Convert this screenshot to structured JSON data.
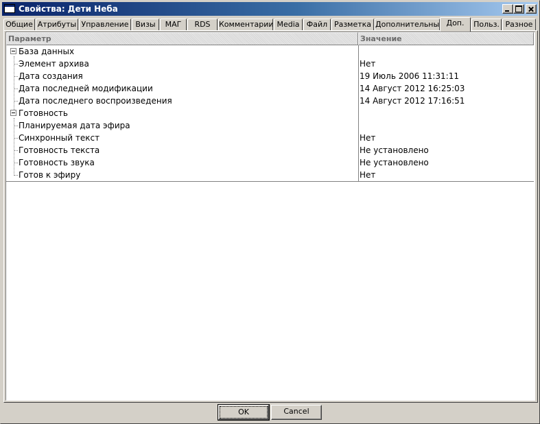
{
  "window": {
    "title": "Свойства: Дети Неба"
  },
  "tabs": [
    {
      "label": "Общие"
    },
    {
      "label": "Атрибуты"
    },
    {
      "label": "Управление"
    },
    {
      "label": "Визы"
    },
    {
      "label": "МАГ"
    },
    {
      "label": "RDS"
    },
    {
      "label": "Комментарии"
    },
    {
      "label": "Media"
    },
    {
      "label": "Файл"
    },
    {
      "label": "Разметка"
    },
    {
      "label": "Дополнительные"
    },
    {
      "label": "Доп.",
      "active": true
    },
    {
      "label": "Польз."
    },
    {
      "label": "Разное"
    }
  ],
  "grid": {
    "columns": {
      "param": "Параметр",
      "value": "Значение"
    },
    "groups": [
      {
        "label": "База данных",
        "rows": [
          {
            "param": "Элемент архива",
            "value": "Нет"
          },
          {
            "param": "Дата создания",
            "value": "19 Июль 2006  11:31:11"
          },
          {
            "param": "Дата последней модификации",
            "value": "14 Август 2012  16:25:03"
          },
          {
            "param": "Дата последнего воспроизведения",
            "value": "14 Август 2012  17:16:51"
          }
        ]
      },
      {
        "label": "Готовность",
        "rows": [
          {
            "param": "Планируемая дата эфира",
            "value": ""
          },
          {
            "param": "Синхронный текст",
            "value": "Нет"
          },
          {
            "param": "Готовность текста",
            "value": "Не установлено"
          },
          {
            "param": "Готовность звука",
            "value": "Не установлено"
          },
          {
            "param": "Готов к эфиру",
            "value": "Нет"
          }
        ]
      }
    ]
  },
  "buttons": {
    "ok": "OK",
    "cancel": "Cancel"
  },
  "colors": {
    "title_start": "#0a246a",
    "title_end": "#a6caf0",
    "face": "#d4d0c8"
  }
}
